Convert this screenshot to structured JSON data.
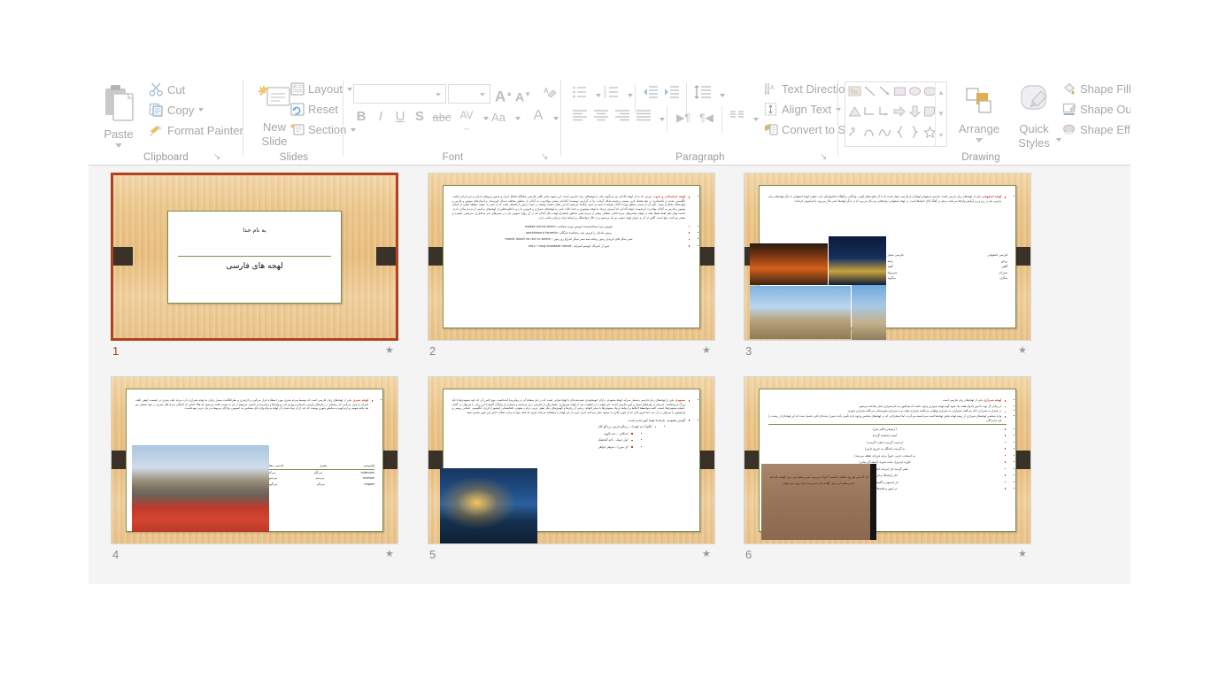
{
  "ribbon": {
    "groups": [
      {
        "name": "Clipboard",
        "items": [
          {
            "label": "Paste"
          },
          {
            "label": "Cut"
          },
          {
            "label": "Copy"
          },
          {
            "label": "Format Painter"
          }
        ]
      },
      {
        "name": "Slides",
        "items": [
          {
            "label": "New",
            "label2": "Slide"
          },
          {
            "label": "Layout"
          },
          {
            "label": "Reset"
          },
          {
            "label": "Section"
          }
        ]
      },
      {
        "name": "Font",
        "font_name": "",
        "font_size": "",
        "items": [
          {
            "label": "B"
          },
          {
            "label": "I"
          },
          {
            "label": "U"
          },
          {
            "label": "S"
          },
          {
            "label": "abc"
          },
          {
            "label": "AV"
          },
          {
            "label": "Aa"
          },
          {
            "label": "A"
          }
        ]
      },
      {
        "name": "Paragraph",
        "items": [
          {
            "label": "Text Direction"
          },
          {
            "label": "Align Text"
          },
          {
            "label": "Convert to SmartArt"
          }
        ]
      },
      {
        "name": "Drawing",
        "items": [
          {
            "label": "Arrange"
          },
          {
            "label": "Quick",
            "label2": "Styles"
          },
          {
            "label": "Shape Fill"
          },
          {
            "label": "Shape Outlir"
          },
          {
            "label": "Shape Effect"
          }
        ]
      }
    ]
  },
  "colors": {
    "selection_border": "#b3411f",
    "selected_slide_number": "#b3411f",
    "slide_number": "#8a8a8a",
    "pane_background": "#f4f4f4",
    "ribbon_background": "#ffffff",
    "disabled_text": "#a8a8a8",
    "slide_wood": "#ecc384",
    "slide_dark_bar": "#3a3229",
    "slide_card_border": "#7e8f4e",
    "heading_red": "#c0392b"
  },
  "slides": [
    {
      "number": "1",
      "selected": true,
      "title_lines": [
        "به نام خدا",
        "لهجه های فارسی"
      ]
    },
    {
      "number": "2",
      "selected": false,
      "heading": "لهجه خراستانی و جنوب غربی ",
      "paragraph": "که به آن لهجه آبادانی نیز می‌گویند یکی از لهجه‌های زبان فارسی است. این شیوه سخن گفتن فارسی بەهنگام اشغال ایران و حضور نیروهای ایرانی و غیر ایرانی (ملیت انگلیسی، هندی و پاکستانی) در دهه هشتاد قرن بیستم برجسته شکل گرفت. بنا به گزارش نویسنده آبادانیان بیشتر مهاجرینی به آبادان از مناطق مختلف شمال خوزستان و استان‌های بوشهر و فارس و چهارمحال بختیاری بودند. تاثیر آن از شدتی منطق تورات آبادان هرفته با سیب و حدود رایافته می‌شود که این نشان دهنده پیشینه در غیره درخور با یکشکل است که از کمتر به عنوان منطقه اصلی از استان بوشهر و فارس به آبادان مهاجرت کردەبودند. لهجه آبادانی که آمیزش نزدیک به لهجه بوشهری و حیات ثالث نامی به لهجه‌های شیرازی و قزوینی دارد و با تفاوت‌هایی از لهجه‌های ترکمنی از مردم ساکن دارند. داشت وفاز نظر لفظ غلطه یکته در لهجه سخنی‌های مردم آبادان انتقالی بیشتر از مردم سایر مناطق استخراج لهجه دیگر آبادان که در آن رواج عمومی دارد در شبی‌های بدتر ساختاری، سریشن، اسپیده و بیشتر نیز ثابت رایج است. گاهی از آن به عنوان لهجه جنوبی نیز یاد می‌شود و در حال خوانشگان و ارتباط ترانه نزدیکی ماشی دارد.",
      "examples": [
        "خویش سرا شناختەشدە خویش سرە شناخت:  madad ma'na ianiim",
        "زمین مادیان را فرو‌تر سە زەچاتىدە فرگكر:  aamidmoo'a faramiin",
        "شیر شکر هان ابریدی زمین رەفتە سە شىر شكر اندراغ رو زمین :  maziin laianii na rani ru aamin",
        "سن از اندرنگ خوشم اسرایە :  ma n i rang khaabare namid"
      ]
    },
    {
      "number": "3",
      "selected": false,
      "heading": "لهجه اصفهانی ",
      "paragraph": "یکی از لهجه‌های زبان پارسی است. فارسی اصفهانی لهجه‌ای از فارسی معیار است که با آن تفاوت‌های آوایی، واژگانی و گهگاه ساختواژه‌ای دارد. تفاوت لهجه اصفهانی با دیگر لهجه‌های زبان پارسی، هم در زیر و زبر آوایش واژه‌ها می‌باشد، و هم در آهنگ ادای جمله‌ها است. در لهجه اصفهانی، واژه‌هایی نیز بکار می‌رود که در دیگر لهجه‌ها کمتر بکار می‌روند یا فراموش کردەاند.",
      "table": {
        "headers": [
          "فارسی اصفهانی",
          "فارسی معیار"
        ],
        "rows": [
          [
            "رفید",
            "رزفن"
          ],
          [
            "کفید",
            "گفتن"
          ],
          [
            "میرزوله",
            "میرزان"
          ],
          [
            "میگوید",
            "میگژن"
          ]
        ]
      }
    },
    {
      "number": "4",
      "selected": false,
      "heading": "لهجه بشری ",
      "paragraph": "یکی از لهجه‌های زبان فارسی است که توسط مردم بشری مورد استفاده قرار می‌گیرد و لازم‌تری و نظرانگاشت بسیار زیادی به لهجه شیرازی دارد مردم علت بشری در قسمت کوهن الفت کنترلی به قرار می‌گیرد که ریشه‌ای در زبان‌های پارسی، باستان و بهتری دارد و واژه‌ها و ترکیب‌بندی دانشی مرسوم در آن به نسبت یافت می‌شود که هنگ اصلی آن لایتنگی مردم اهل بشری در کوه نشینان نیز بعد بختە شهمی و ازبرکویم به مناطق شهری یوشت که چند از آن تولد نشدن آن لهجه به وام واژه ه‌ای مشخص به خصوص، واژگان مربوط به زبان عربی نبودەاست.",
      "table": {
        "headers": [
          "فارسی معیار",
          "بشری",
          "آوانویسی"
        ],
        "rows": [
          [
            "می‌کنم",
            "می‌کنُم",
            "mikonom"
          ],
          [
            "می‌شوم",
            "می‌شم",
            "misham"
          ],
          [
            "می‌گویم",
            "می‌گم",
            "migam"
          ]
        ]
      }
    },
    {
      "number": "5",
      "selected": false,
      "heading": "مشهدی ",
      "paragraph": "یکی از لهجه‌های زبان فارسی بەشمار می‌آید. لهجهٔ مشهدی، دارای خویشاوندی تثبیت‌شده‌ای با لهجهٔ هراتی است که در ذیل صفحهٔ آن در ویکی‌پدیا آمدەاست. نوع خاص آن، که خود مشهدی‌ها با نام بزرگ می‌شناسند، سرشار از واژه‌های اصیل و کهن فارسی است. این لهجه را درحقیقت، بعد از لهجه سبزواری، معماری‌ای از فارسی دری می‌دانند و بسیاری از واژگان گمشده این زبان را می‌توان در گفتار عامیانه مشهدی‌ها جست. البته بەواسطهٔ اختلاط و ارتباط نزدیک مشهدی‌ها با سایر اقوام، ردپایی از زبان‌ها و گویش‌های دیگر نظیر عربی، ترکی، مغولی، افغانستانی (پشتون) کردی، انگلیسی، عثمانی روسی و فرانسوی را می‌توان در آن دید. اما امروز آنان که از شهر دیگری به مشهد سفر می‌کنند، اثری غریب از این لهجه را مشاهده می‌کنند چیزی که شاید تنها به برخی محلات خاص این شهر محدود شود.",
      "examples": [
        "گویش مشهدی، بازماندهٔ لهجهٔ کهن قدیم است.",
        "انگوک (به فتح ا) – زردآلو نارس، زردآلو کال",
        "اشکاف – نمد نالهیە",
        "آمل چمک – لانه گنجشک",
        "آی میرزا – شوهر خواهر"
      ]
    },
    {
      "number": "6",
      "selected": false,
      "heading": "لهجه شیرازی ",
      "intro": "یکی از لهجه‌های زبان فارسی است.",
      "paragraphs": [
        "از زمانی آل بویه تا امین الدوله هفت یک شوه گونه لهجه شیرازی وجود داشته که هم‌اکنون به نام شیرازی اصل شناخته می‌شود.",
        "در شیراز به شیرازی حاته می‌گفتند شیرازی، به شیرازی پهلوانی می‌گفتند شیرازی هفت و به شیرازی شهرستانی می‌گفته شیرازی شهری.",
        "واژه شناسی لهجه‌های شیرازی از ریشه لهجه بخش لهجه‌ها است می‌دانسته می‌گردند اما استخراجی که در لهجه‌های شکسن وجوه دارە تأمین باعث شیراز شده‌ای لکنن تحمیل شده که این لهجه‌ای از ریشت را هم ندارندگان."
      ],
      "examples": [
        "آ (پسخر) (آلم بخر)",
        "استه (بەاسته گِردە)",
        "ازدست گرمت (خفت گرمت)",
        "به گرمت (اشگار به خروج دامن)",
        "یه (سخت، عزیز، خوراً برایه فرزانه نقطه می‌شد)",
        "تأوژه (بەزیر)، بابت شیره (جمله گر بیاتی)",
        "تشر گرمت (از امرلت ایخانی نیمە‌ده)",
        "جاز (راشنگ و فرادو)",
        "خر (بەمهر و گلستانی)",
        "نر (مهر و فلسفانی)",
        "تقرت (هریە سریاق)"
      ],
      "quote": "آن که من هر وی بانقام جاسمه ک‌ارک می‌پرنه نمی‌رسقم ارم برى کهامه ناه شد نمی‌رسقم ارم نوی کهامه نام نمی‌رسه نران وری می‌خوام"
    }
  ]
}
